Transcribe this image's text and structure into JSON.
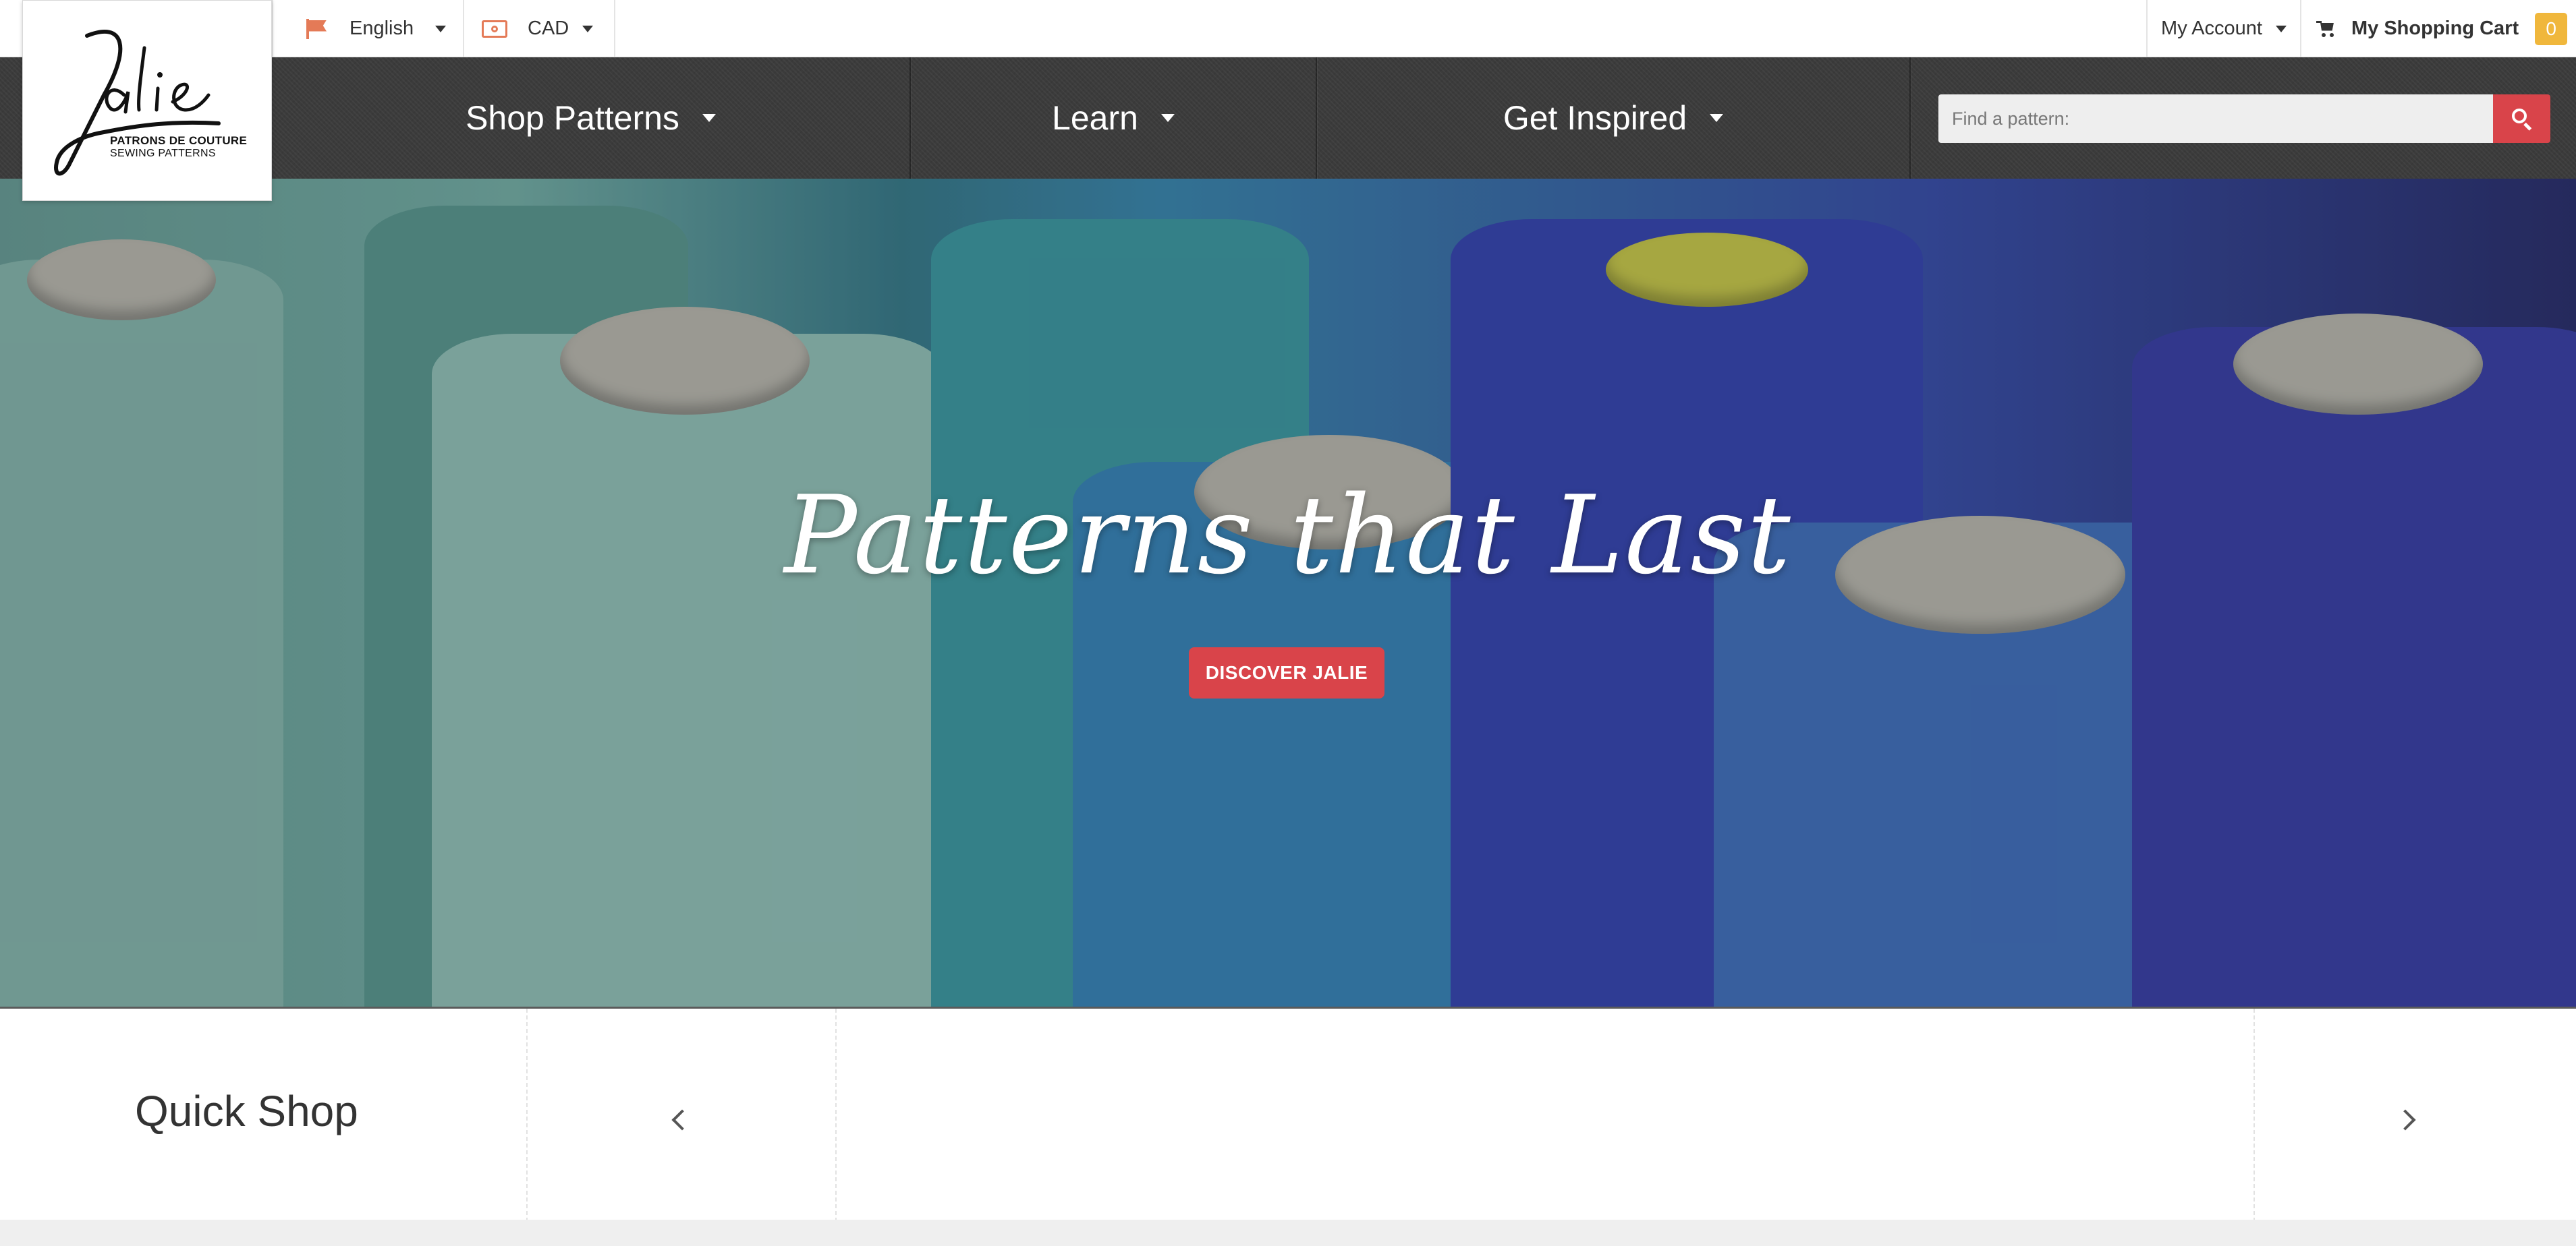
{
  "topbar": {
    "language": {
      "label": "English",
      "icon": "flag-icon"
    },
    "currency": {
      "label": "CAD",
      "icon": "money-icon"
    },
    "account": {
      "label": "My Account"
    },
    "cart": {
      "label": "My Shopping Cart",
      "count": "0",
      "icon": "cart-icon"
    }
  },
  "logo": {
    "wordmark": "Jalie",
    "line1": "PATRONS DE COUTURE",
    "line2": "SEWING PATTERNS"
  },
  "nav": {
    "items": [
      {
        "label": "Shop Patterns"
      },
      {
        "label": "Learn"
      },
      {
        "label": "Get Inspired"
      }
    ]
  },
  "search": {
    "placeholder": "Find a pattern:",
    "value": ""
  },
  "hero": {
    "title": "Patterns that Last",
    "button": "DISCOVER JALIE"
  },
  "quickshop": {
    "title": "Quick Shop"
  },
  "colors": {
    "accent_red": "#d9444a",
    "badge_yellow": "#f0b73c",
    "nav_bg": "#3b3b3b",
    "icon_orange": "#e47a57"
  }
}
